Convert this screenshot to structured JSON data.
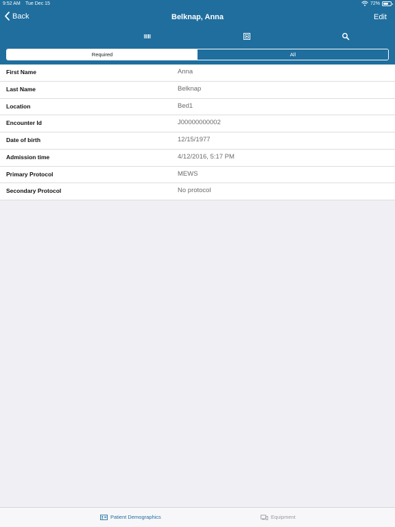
{
  "status_bar": {
    "time": "9:52 AM",
    "date": "Tue Dec 15",
    "battery": "72%",
    "battery_level": 0.72
  },
  "nav": {
    "back_label": "Back",
    "title": "Belknap, Anna",
    "edit_label": "Edit"
  },
  "segments": [
    {
      "label": "Required",
      "selected": true
    },
    {
      "label": "All",
      "selected": false
    }
  ],
  "fields": [
    {
      "label": "First Name",
      "value": "Anna"
    },
    {
      "label": "Last Name",
      "value": "Belknap"
    },
    {
      "label": "Location",
      "value": "Bed1"
    },
    {
      "label": "Encounter Id",
      "value": "J00000000002"
    },
    {
      "label": "Date of birth",
      "value": "12/15/1977"
    },
    {
      "label": "Admission time",
      "value": "4/12/2016, 5:17 PM"
    },
    {
      "label": "Primary Protocol",
      "value": "MEWS"
    },
    {
      "label": "Secondary Protocol",
      "value": "No protocol"
    }
  ],
  "tabs": [
    {
      "label": "Patient Demographics",
      "icon": "id-card-icon",
      "selected": true
    },
    {
      "label": "Equipment",
      "icon": "equipment-icon",
      "selected": false
    }
  ],
  "colors": {
    "header": "#1f6e9e",
    "accent": "#1f6e9e"
  }
}
